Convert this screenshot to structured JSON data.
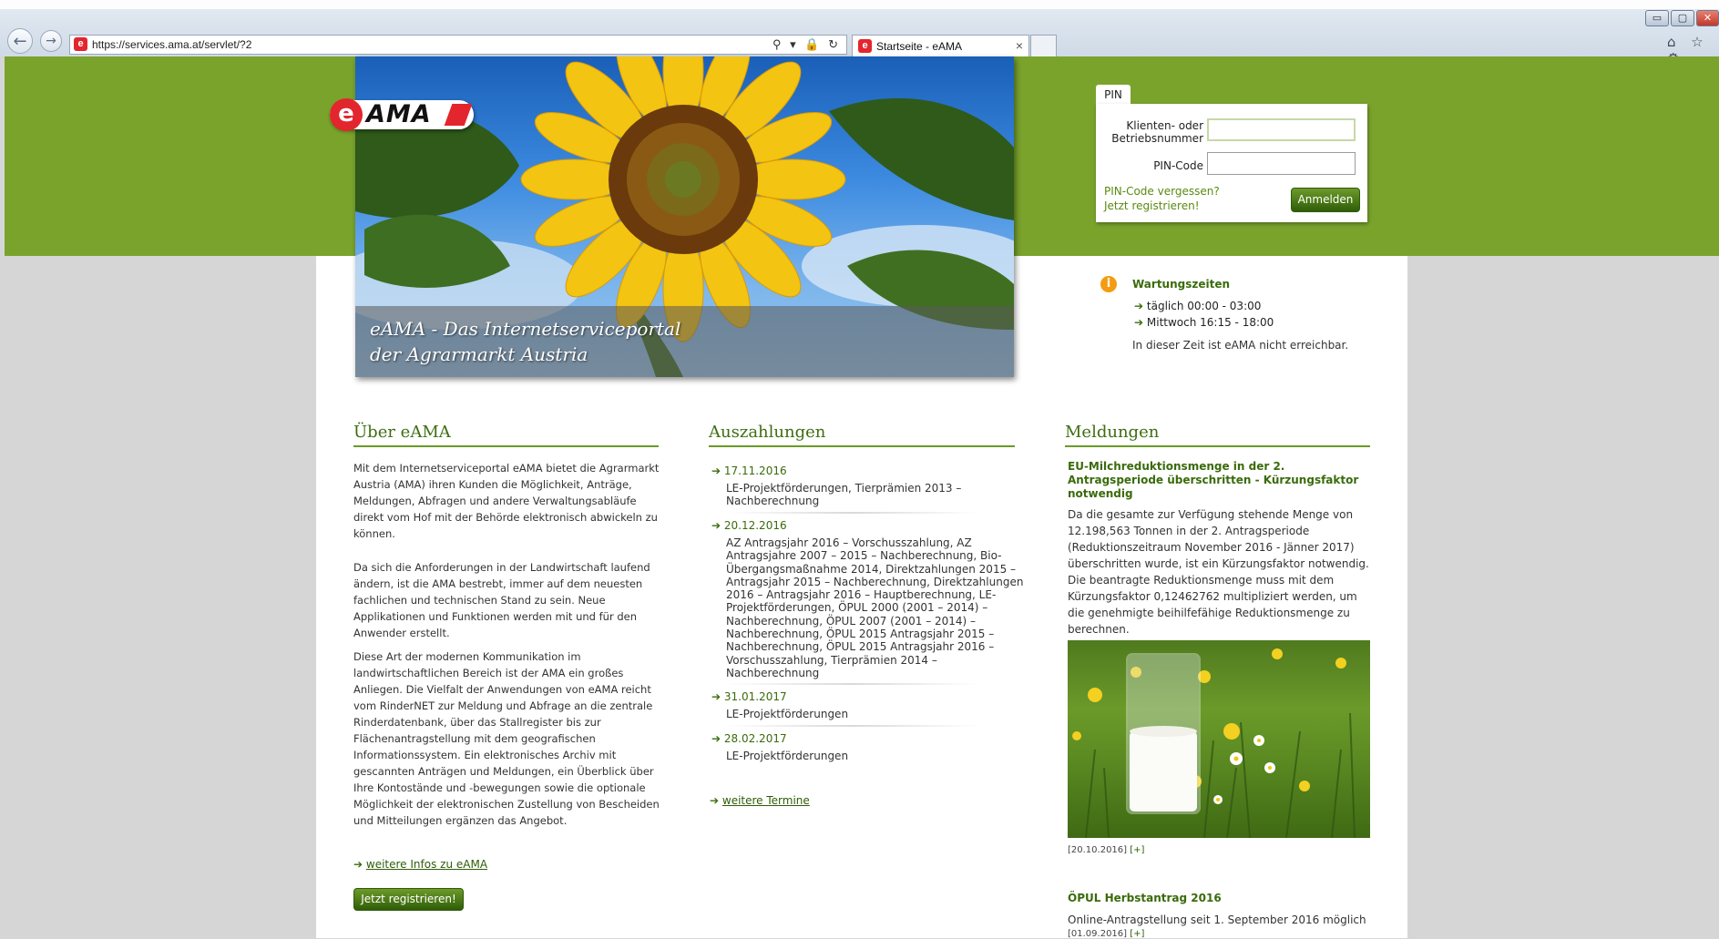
{
  "browser": {
    "url": "https://services.ama.at/servlet/?2",
    "tab_title": "Startseite - eAMA",
    "tab_close": "×",
    "address_icons": "⚲ ▾ 🔒 ↻",
    "back": "←",
    "forward": "→",
    "win_min": "▭",
    "win_max": "▢",
    "win_close": "✕",
    "right_icons": "⌂ ☆ ⚙",
    "favicon_letter": "e"
  },
  "logo": {
    "letter": "e",
    "text": "AMA"
  },
  "hero": {
    "caption_line1": "eAMA - Das Internetserviceportal",
    "caption_line2": "der Agrarmarkt Austria"
  },
  "login": {
    "tab_label": "PIN",
    "client_label_line1": "Klienten- oder",
    "client_label_line2": "Betriebsnummer",
    "client_value": "",
    "pin_label": "PIN-Code",
    "pin_value": "",
    "forgot_link": "PIN-Code vergessen?",
    "register_link": "Jetzt registrieren!",
    "submit_label": "Anmelden"
  },
  "maintenance": {
    "icon": "i",
    "title": "Wartungszeiten",
    "arrow": "➔",
    "lines": [
      "täglich 00:00 - 03:00",
      "Mittwoch 16:15 - 18:00"
    ],
    "note": "In dieser Zeit ist eAMA nicht erreichbar."
  },
  "about": {
    "heading": "Über eAMA",
    "paragraphs": [
      "Mit dem Internetserviceportal eAMA bietet die Agrarmarkt Austria (AMA) ihren Kunden die Möglichkeit, Anträge, Meldungen, Abfragen und andere Verwaltungsabläufe direkt vom Hof mit der Behörde elektronisch abwickeln zu können.",
      "Da sich die Anforderungen in der Landwirtschaft laufend ändern, ist die AMA bestrebt, immer auf dem neuesten fachlichen und technischen Stand zu sein. Neue Applikationen und Funktionen werden mit und für den Anwender erstellt.",
      "Diese Art der modernen Kommunikation im landwirtschaftlichen Bereich ist der AMA ein großes Anliegen. Die Vielfalt der Anwendungen von eAMA reicht vom RinderNET zur Meldung und Abfrage an die zentrale Rinderdatenbank, über das Stallregister bis zur Flächenantragstellung mit dem geografischen Informationssystem. Ein elektronisches Archiv mit gescannten Anträgen und Meldungen, ein Überblick über Ihre Kontostände und -bewegungen sowie die optionale Möglichkeit der elektronischen Zustellung von Bescheiden und Mitteilungen ergänzen das Angebot."
    ],
    "more_link": "weitere Infos zu eAMA",
    "register_button": "Jetzt registrieren!"
  },
  "payments": {
    "heading": "Auszahlungen",
    "items": [
      {
        "date": "17.11.2016",
        "desc": "LE-Projektförderungen, Tierprämien 2013 – Nachberechnung"
      },
      {
        "date": "20.12.2016",
        "desc": "AZ Antragsjahr 2016 – Vorschusszahlung, AZ Antragsjahre 2007 – 2015 – Nachberechnung, Bio-Übergangsmaßnahme 2014, Direktzahlungen 2015 – Antragsjahr 2015 – Nachberechnung, Direktzahlungen 2016 – Antragsjahr 2016 – Hauptberechnung, LE-Projektförderungen, ÖPUL 2000 (2001 – 2014) – Nachberechnung, ÖPUL 2007 (2001 – 2014) – Nachberechnung, ÖPUL 2015 Antragsjahr 2015 – Nachberechnung, ÖPUL 2015 Antragsjahr 2016 – Vorschusszahlung, Tierprämien 2014 – Nachberechnung"
      },
      {
        "date": "31.01.2017",
        "desc": "LE-Projektförderungen"
      },
      {
        "date": "28.02.2017",
        "desc": "LE-Projektförderungen"
      }
    ],
    "more_link": "weitere Termine"
  },
  "news": {
    "heading": "Meldungen",
    "item1": {
      "title": "EU-Milchreduktionsmenge in der 2. Antragsperiode überschritten - Kürzungsfaktor notwendig",
      "text": "Da die gesamte zur Verfügung stehende Menge von 12.198,563 Tonnen in der 2. Antragsperiode (Reduktionszeitraum November 2016 - Jänner 2017) überschritten wurde, ist ein Kürzungsfaktor notwendig. Die beantragte Reduktionsmenge muss mit dem Kürzungsfaktor 0,12462762 multipliziert werden, um die genehmigte beihilfefähige Reduktionsmenge zu berechnen.",
      "date": "[20.10.2016]",
      "plus": "[+]"
    },
    "item2": {
      "title": "ÖPUL Herbstantrag 2016",
      "text": "Online-Antragstellung seit 1. September 2016 möglich",
      "date": "[01.09.2016]",
      "plus": "[+]"
    }
  },
  "colors": {
    "brand_green": "#7aa32c",
    "heading_green": "#3f6d10",
    "link_green": "#2f5d08",
    "ama_red": "#e3252d",
    "warning_orange": "#f39c12"
  }
}
